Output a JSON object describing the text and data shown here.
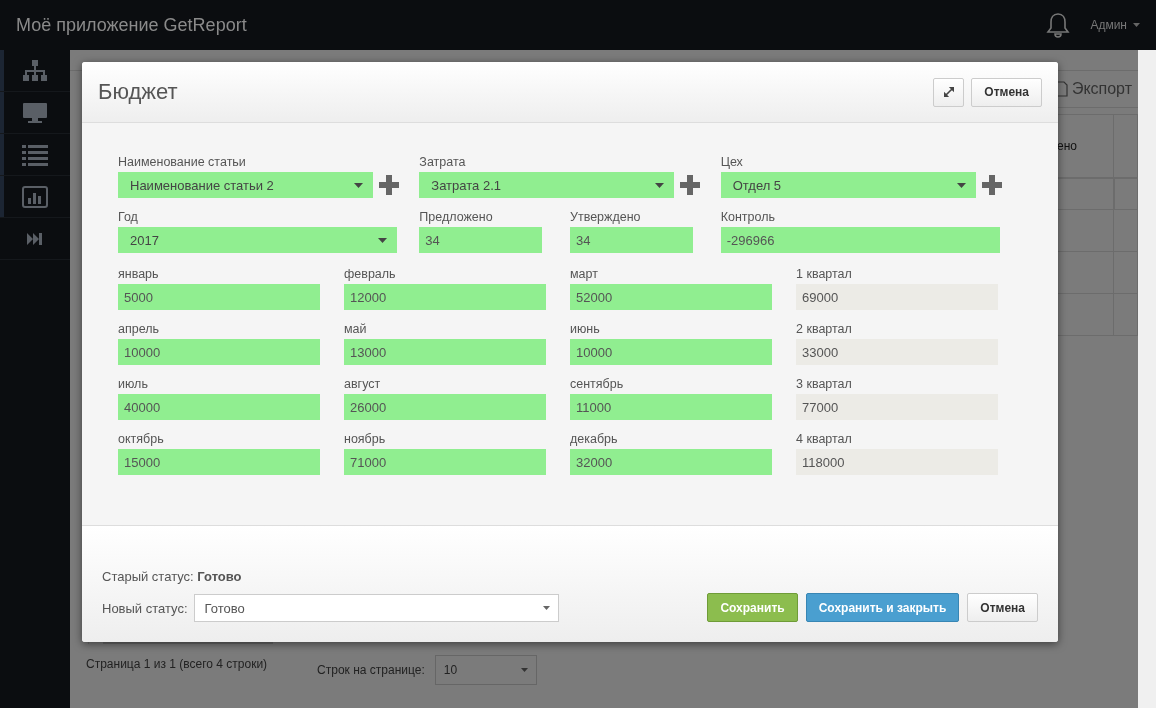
{
  "app": {
    "title": "Моё приложение GetReport",
    "user": "Админ"
  },
  "background": {
    "export_button": "Экспорт",
    "column_header": "ено",
    "summary": "Страница 1 из 1 (всего 4 строки)",
    "page_size_label": "Строк на странице:",
    "page_size": "10"
  },
  "dialog": {
    "title": "Бюджет",
    "cancel_top": "Отмена",
    "selectors": [
      {
        "label": "Наименование статьи",
        "value": "Наименование статьи 2"
      },
      {
        "label": "Затрата",
        "value": "Затрата 2.1"
      },
      {
        "label": "Цех",
        "value": "Отдел 5"
      }
    ],
    "year": {
      "label": "Год",
      "value": "2017"
    },
    "figures": [
      {
        "label": "Предложено",
        "value": "34",
        "kind": "short"
      },
      {
        "label": "Утверждено",
        "value": "34",
        "kind": "short"
      },
      {
        "label": "Контроль",
        "value": "-296966",
        "kind": "wide"
      }
    ],
    "months": [
      {
        "label": "январь",
        "value": "5000",
        "kind": "month"
      },
      {
        "label": "февраль",
        "value": "12000",
        "kind": "month"
      },
      {
        "label": "март",
        "value": "52000",
        "kind": "month"
      },
      {
        "label": "1 квартал",
        "value": "69000",
        "kind": "quarter"
      },
      {
        "label": "апрель",
        "value": "10000",
        "kind": "month"
      },
      {
        "label": "май",
        "value": "13000",
        "kind": "month"
      },
      {
        "label": "июнь",
        "value": "10000",
        "kind": "month"
      },
      {
        "label": "2 квартал",
        "value": "33000",
        "kind": "quarter"
      },
      {
        "label": "июль",
        "value": "40000",
        "kind": "month"
      },
      {
        "label": "август",
        "value": "26000",
        "kind": "month"
      },
      {
        "label": "сентябрь",
        "value": "11000",
        "kind": "month"
      },
      {
        "label": "3 квартал",
        "value": "77000",
        "kind": "quarter"
      },
      {
        "label": "октябрь",
        "value": "15000",
        "kind": "month"
      },
      {
        "label": "ноябрь",
        "value": "71000",
        "kind": "month"
      },
      {
        "label": "декабрь",
        "value": "32000",
        "kind": "month"
      },
      {
        "label": "4 квартал",
        "value": "118000",
        "kind": "quarter"
      }
    ],
    "old_status": "Старый статус: **Готово**",
    "new_status": {
      "label": "Новый статус:",
      "value": "Готово"
    },
    "buttons": [
      {
        "label": "Сохранить",
        "kind": "success"
      },
      {
        "label": "Сохранить и закрыть",
        "kind": "primary"
      },
      {
        "label": "Отмена",
        "kind": "default"
      }
    ]
  }
}
